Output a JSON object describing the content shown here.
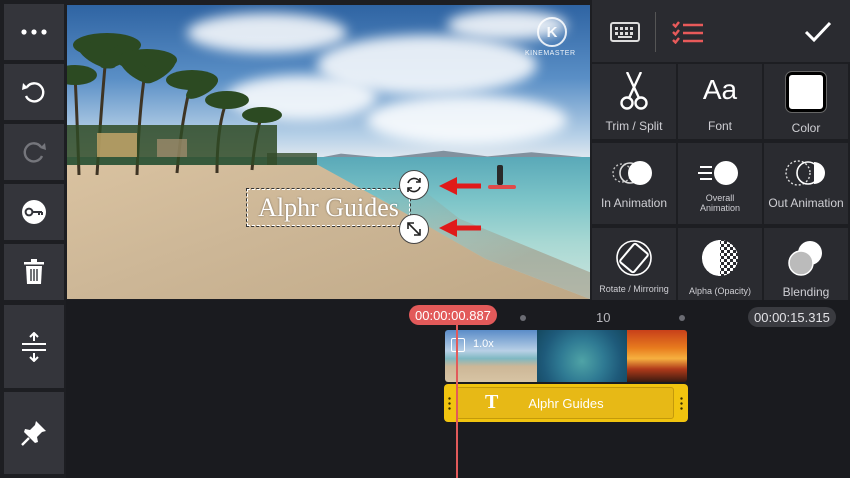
{
  "left_toolbar": {
    "items": [
      {
        "name": "more-button",
        "icon": "more-dots-icon"
      },
      {
        "name": "undo-button",
        "icon": "undo-icon"
      },
      {
        "name": "redo-button",
        "icon": "redo-icon"
      },
      {
        "name": "keyframe-button",
        "icon": "key-icon"
      },
      {
        "name": "delete-button",
        "icon": "trash-icon"
      }
    ],
    "bottom_items": [
      {
        "name": "timeline-expand-button",
        "icon": "expand-vertical-icon"
      },
      {
        "name": "pin-button",
        "icon": "pin-icon"
      }
    ]
  },
  "preview": {
    "watermark_logo": "K",
    "watermark_text": "KINEMASTER",
    "text_layer": "Alphr Guides"
  },
  "right_panel": {
    "top_icons": [
      "keyboard-icon",
      "checklist-icon",
      "checkmark-icon"
    ],
    "options": [
      {
        "label": "Trim / Split",
        "icon": "scissors-icon"
      },
      {
        "label": "Font",
        "icon": "font-icon",
        "glyph": "Aa"
      },
      {
        "label": "Color",
        "icon": "color-swatch-icon"
      },
      {
        "label": "In Animation",
        "icon": "in-animation-icon"
      },
      {
        "label": "Overall Animation",
        "icon": "overall-animation-icon"
      },
      {
        "label": "Out Animation",
        "icon": "out-animation-icon"
      },
      {
        "label": "Rotate / Mirroring",
        "icon": "rotate-icon"
      },
      {
        "label": "Alpha (Opacity)",
        "icon": "alpha-icon"
      },
      {
        "label": "Blending",
        "icon": "blending-icon"
      }
    ]
  },
  "timeline": {
    "current_time": "00:00:00.887",
    "total_time": "00:00:15.315",
    "ruler_label": "10",
    "clip_speed": "1.0x",
    "text_clip_label": "Alphr Guides",
    "text_clip_icon": "T"
  },
  "colors": {
    "accent_red": "#e25a5a",
    "text_clip_yellow": "#f1c40f",
    "panel_bg": "#2a2b30"
  }
}
